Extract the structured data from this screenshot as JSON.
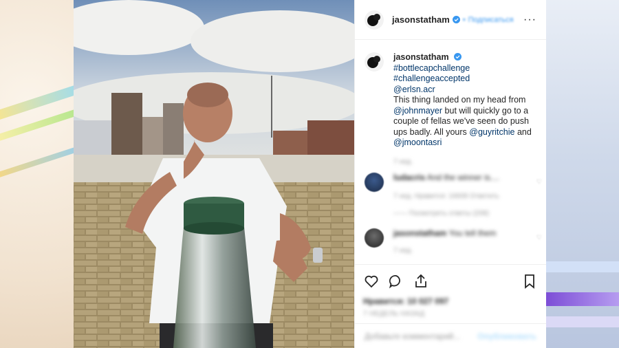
{
  "header": {
    "username": "jasonstatham",
    "separator": "•",
    "follow_label": "Подписаться",
    "more_label": "···"
  },
  "caption": {
    "username": "jasonstatham",
    "hashtag1": "#bottlecapchallenge",
    "hashtag2": "#challengeaccepted",
    "mention1": "@erlsn.acr",
    "text1": "This thing landed on my head from",
    "mention2": "@johnmayer",
    "text2": "but will quickly go to a couple of fellas we've seen do push ups badly. All yours",
    "mention3": "@guyritchie",
    "text3": "and",
    "mention4": "@jmoontasri",
    "age": "7 нед."
  },
  "comments": [
    {
      "user": "ludacris",
      "text": "And the winner is....",
      "meta": "7 нед.   Нравится: 16608   Ответить",
      "replies": "—— Посмотреть ответы (208)"
    },
    {
      "user": "jasonstatham",
      "text": "You tell them",
      "meta": "7 нед."
    }
  ],
  "footer": {
    "likes": "Нравится: 10 027 097",
    "time": "7 НЕДЕЛЬ НАЗАД",
    "add_comment_placeholder": "Добавьте комментарий...",
    "publish_label": "Опубликовать"
  },
  "colors": {
    "link": "#003569",
    "verified": "#3897f0",
    "follow": "#3897f0"
  }
}
